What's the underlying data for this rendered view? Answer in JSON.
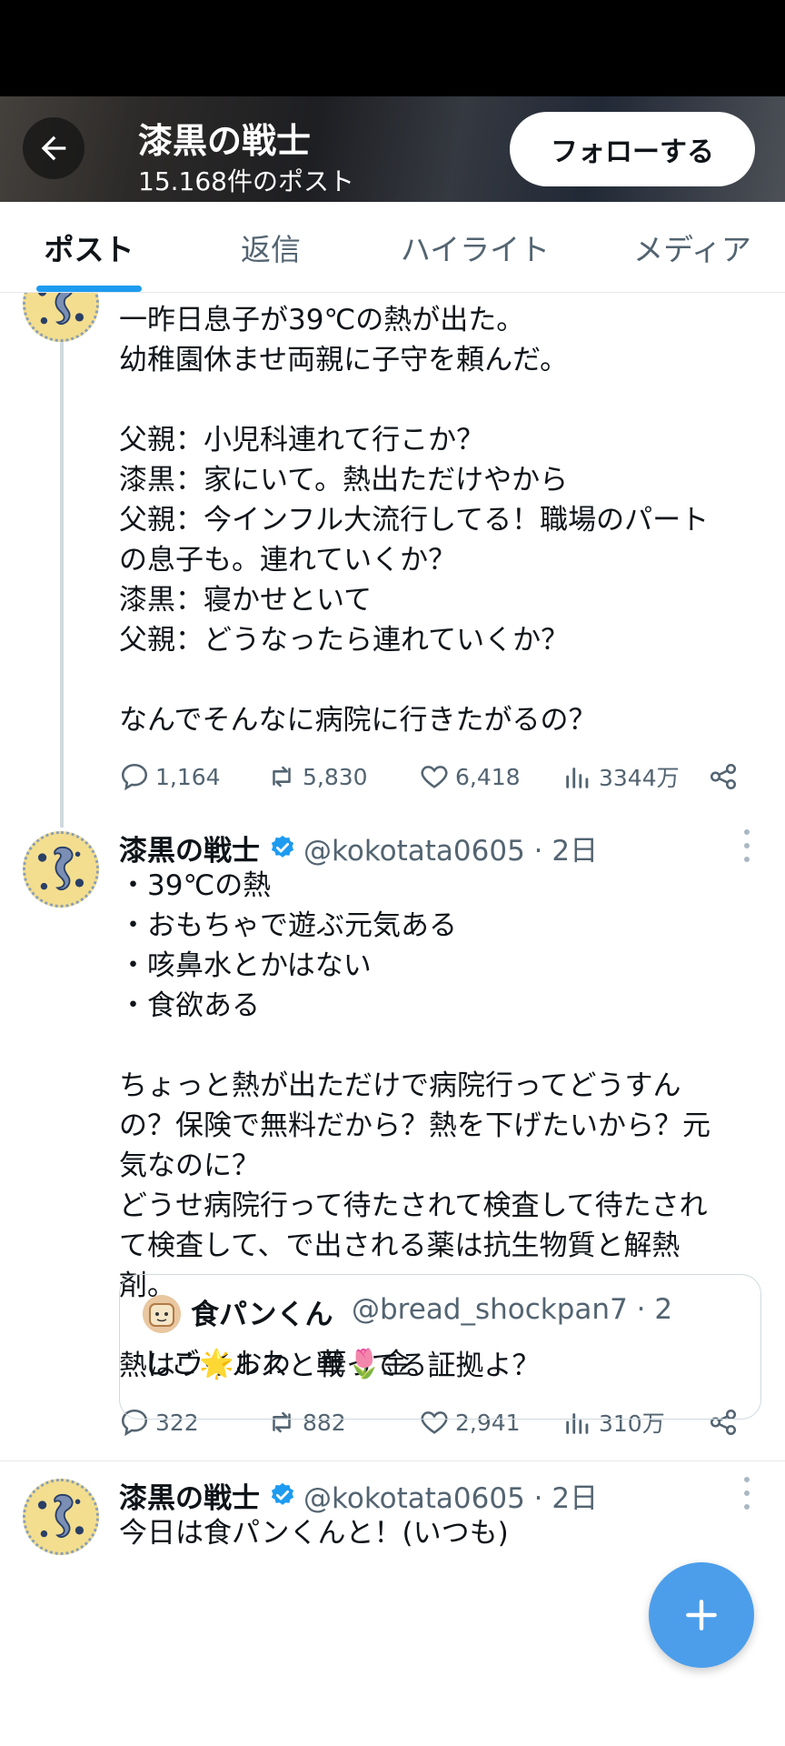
{
  "header": {
    "title": "漆黒の戦士",
    "post_count": "15.168件のポスト",
    "follow_label": "フォローする"
  },
  "tabs": [
    {
      "label": "ポスト"
    },
    {
      "label": "返信"
    },
    {
      "label": "ハイライト"
    },
    {
      "label": "メディア"
    }
  ],
  "posts": [
    {
      "text": "一昨日息子が39℃の熱が出た。\n幼稚園休ませ両親に子守を頼んだ。\n\n父親：小児科連れて行こか？\n漆黒：家にいて。熱出ただけやから\n父親：今インフル大流行してる！職場のパート\nの息子も。連れていくか？\n漆黒：寝かせといて\n父親：どうなったら連れていくか？\n\nなんでそんなに病院に行きたがるの？",
      "replies": "1,164",
      "reposts": "5,830",
      "likes": "6,418",
      "views": "3344万"
    },
    {
      "name": "漆黒の戦士",
      "handle": "@kokotata0605 · 2日",
      "text": "・39℃の熱\n・おもちゃで遊ぶ元気ある\n・咳鼻水とかはない\n・食欲ある\n\nちょっと熱が出ただけで病院行ってどうすん\nの？保険で無料だから？熱を下げたいから？元\n気なのに？\nどうせ病院行って待たされて検査して待たされ\nて検査して、で出される薬は抗生物質と解熱\n剤。\n\n熱はウイルスと戦ってる証拠よ？",
      "replies": "322",
      "reposts": "882",
      "likes": "2,941",
      "views": "310万"
    },
    {
      "name": "漆黒の戦士",
      "handle": "@kokotata0605 · 2日",
      "text": "今日は食パンくんと！(いつも)",
      "quote": {
        "name": "食パンくん",
        "handle": "@bread_shockpan7 · 2",
        "text": "しご🌟おわ　華🌷金"
      }
    }
  ],
  "icons": {
    "back": "arrow-left-icon",
    "verified": "verified-badge-icon",
    "reply": "reply-icon",
    "repost": "repost-icon",
    "like": "heart-icon",
    "views": "bar-chart-icon",
    "share": "share-icon",
    "compose": "plus-icon"
  },
  "colors": {
    "accent": "#1d9bf0",
    "fab": "#4c9eeb",
    "muted": "#536471"
  }
}
